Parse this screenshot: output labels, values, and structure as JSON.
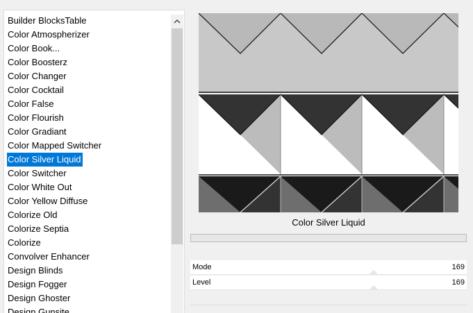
{
  "filter_list": {
    "items": [
      "Builder BlocksTable",
      "Color Atmospherizer",
      "Color Book...",
      "Color Boosterz",
      "Color Changer",
      "Color Cocktail",
      "Color False",
      "Color Flourish",
      "Color Gradiant",
      "Color Mapped Switcher",
      "Color Silver Liquid",
      "Color Switcher",
      "Color White Out",
      "Color Yellow Diffuse",
      "Colorize Old",
      "Colorize Septia",
      "Colorize",
      "Convolver Enhancer",
      "Design Blinds",
      "Design Fogger",
      "Design Ghoster",
      "Design Gunsite"
    ],
    "selected_index": 10
  },
  "scrollbar": {
    "up_icon": "chevron-up-icon"
  },
  "filter_panel": {
    "filter_name": "Color Silver Liquid",
    "params": [
      {
        "label": "Mode",
        "value": "169"
      },
      {
        "label": "Level",
        "value": "169"
      }
    ]
  },
  "colors": {
    "selection": "#0078d7",
    "preview_light_gray": "#c8c8c8",
    "preview_mid_gray": "#bcbcbc",
    "preview_dark": "#333333",
    "preview_black": "#1a1a1a"
  }
}
